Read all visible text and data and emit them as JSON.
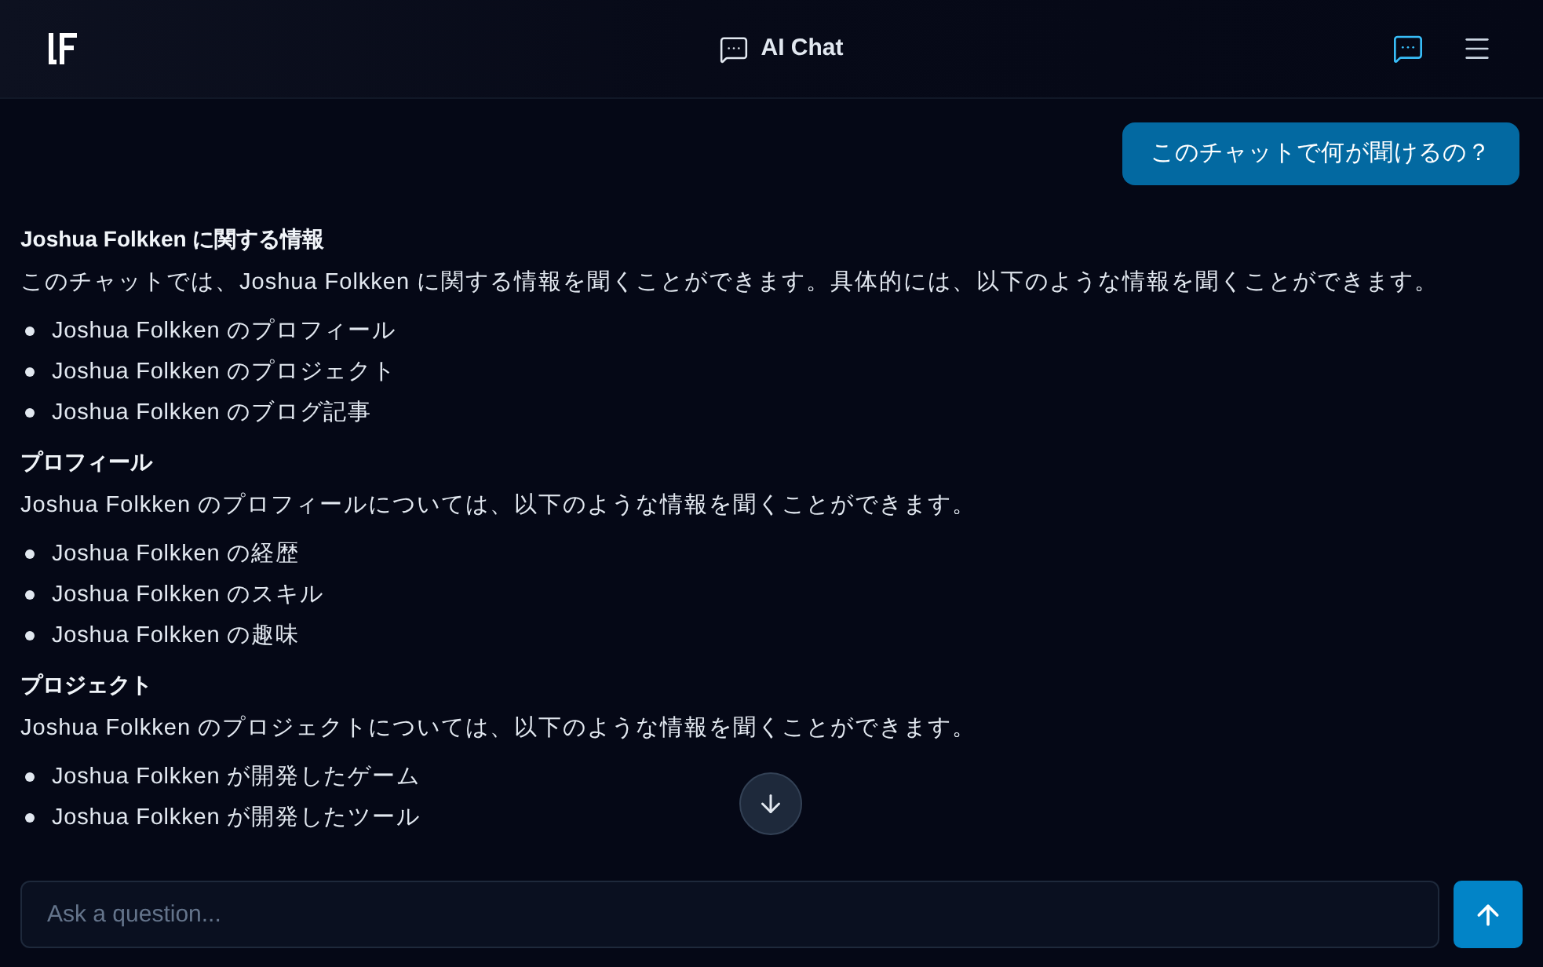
{
  "header": {
    "title": "AI Chat",
    "nav": [
      {
        "kind": "chat",
        "selected": true
      },
      {
        "kind": "menu",
        "selected": false
      }
    ]
  },
  "messages": [
    {
      "kind": "bubble",
      "text": "このチャットで何が聞けるの？"
    },
    {
      "kind": "reply",
      "blocks": [
        {
          "kind": "heading",
          "text": "Joshua Folkken に関する情報"
        },
        {
          "kind": "paragraph",
          "text": "このチャットでは、Joshua Folkken に関する情報を聞くことができます。具体的には、以下のような情報を聞くことができます。"
        },
        {
          "kind": "list",
          "items": [
            "Joshua Folkken のプロフィール",
            "Joshua Folkken のプロジェクト",
            "Joshua Folkken のブログ記事"
          ]
        },
        {
          "kind": "heading",
          "text": "プロフィール"
        },
        {
          "kind": "paragraph",
          "text": "Joshua Folkken のプロフィールについては、以下のような情報を聞くことができます。"
        },
        {
          "kind": "list",
          "items": [
            "Joshua Folkken の経歴",
            "Joshua Folkken のスキル",
            "Joshua Folkken の趣味"
          ]
        },
        {
          "kind": "heading",
          "text": "プロジェクト"
        },
        {
          "kind": "paragraph",
          "text": "Joshua Folkken のプロジェクトについては、以下のような情報を聞くことができます。"
        },
        {
          "kind": "list",
          "items": [
            "Joshua Folkken が開発したゲーム",
            "Joshua Folkken が開発したツール"
          ]
        }
      ]
    }
  ],
  "composer": {
    "placeholder": "Ask a question..."
  }
}
